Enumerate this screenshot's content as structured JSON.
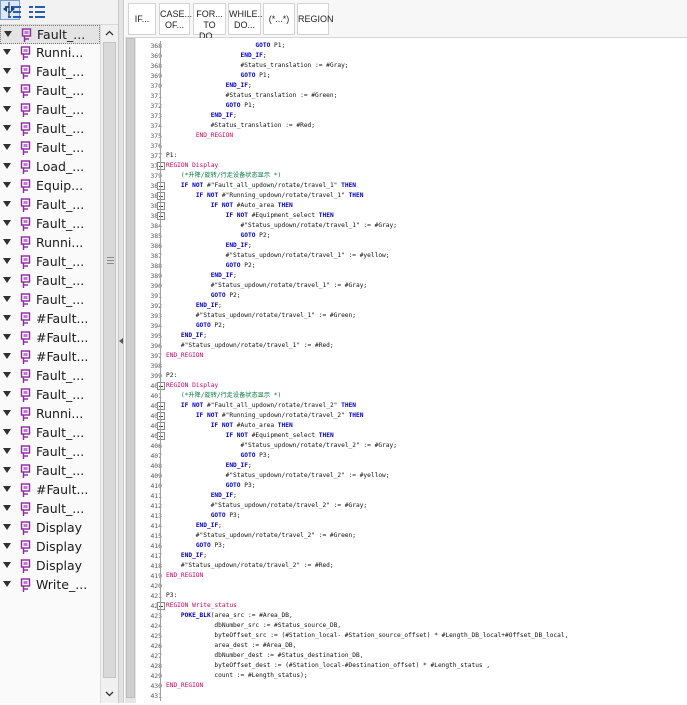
{
  "tree": {
    "items": [
      {
        "label": "Fault_..."
      },
      {
        "label": "Runni..."
      },
      {
        "label": "Fault_..."
      },
      {
        "label": "Fault_..."
      },
      {
        "label": "Fault_..."
      },
      {
        "label": "Fault_..."
      },
      {
        "label": "Fault_..."
      },
      {
        "label": "Load_..."
      },
      {
        "label": "Equip..."
      },
      {
        "label": "Fault_..."
      },
      {
        "label": "Fault_..."
      },
      {
        "label": "Runni..."
      },
      {
        "label": "Fault_..."
      },
      {
        "label": "Fault_..."
      },
      {
        "label": "Fault_..."
      },
      {
        "label": "#Fault..."
      },
      {
        "label": "#Fault..."
      },
      {
        "label": "#Fault..."
      },
      {
        "label": "Fault_..."
      },
      {
        "label": "Fault_..."
      },
      {
        "label": "Runni..."
      },
      {
        "label": "Fault_..."
      },
      {
        "label": "Fault_..."
      },
      {
        "label": "Fault_..."
      },
      {
        "label": "#Fault..."
      },
      {
        "label": "Fault_..."
      },
      {
        "label": "Display"
      },
      {
        "label": "Display"
      },
      {
        "label": "Display"
      },
      {
        "label": "Write_..."
      }
    ],
    "selected_index": 0,
    "icon": "tag-icon"
  },
  "snippets": [
    {
      "line1": "IF...",
      "line2": ""
    },
    {
      "line1": "CASE...",
      "line2": "OF..."
    },
    {
      "line1": "FOR...",
      "line2": "TO DO..."
    },
    {
      "line1": "WHILE...",
      "line2": "DO..."
    },
    {
      "line1": "(*...*)",
      "line2": ""
    },
    {
      "line1": "REGION",
      "line2": ""
    }
  ],
  "colors": {
    "keyword": "#0000cc",
    "comment": "#007a3d",
    "region": "#cc0066"
  },
  "code": [
    {
      "n": "368",
      "t": "                        GOTO P1;"
    },
    {
      "n": "369",
      "t": "                    END_IF;"
    },
    {
      "n": "368",
      "t": "                    #Status_translation := #Gray;"
    },
    {
      "n": "369",
      "t": "                    GOTO P1;"
    },
    {
      "n": "370",
      "t": "                END_IF;"
    },
    {
      "n": "371",
      "t": "                #Status_translation := #Green;"
    },
    {
      "n": "372",
      "t": "                GOTO P1;"
    },
    {
      "n": "373",
      "t": "            END_IF;"
    },
    {
      "n": "374",
      "t": "            #Status_translation := #Red;"
    },
    {
      "n": "375",
      "t": "        END_REGION"
    },
    {
      "n": "376",
      "t": ""
    },
    {
      "n": "377",
      "t": "P1:"
    },
    {
      "n": "378",
      "t": "REGION Display"
    },
    {
      "n": "379",
      "t": "    (*升降/旋转/行走设备状态显示 *)"
    },
    {
      "n": "380",
      "t": "    IF NOT #\"Fault_all_updown/rotate/travel_1\" THEN"
    },
    {
      "n": "381",
      "t": "        IF NOT #\"Running_updown/rotate/travel_1\" THEN"
    },
    {
      "n": "382",
      "t": "            IF NOT #Auto_area THEN"
    },
    {
      "n": "383",
      "t": "                IF NOT #Equipment_select THEN"
    },
    {
      "n": "384",
      "t": "                    #\"Status_updown/rotate/travel_1\" := #Gray;"
    },
    {
      "n": "385",
      "t": "                    GOTO P2;"
    },
    {
      "n": "386",
      "t": "                END_IF;"
    },
    {
      "n": "387",
      "t": "                #\"Status_updown/rotate/travel_1\" := #yellow;"
    },
    {
      "n": "388",
      "t": "                GOTO P2;"
    },
    {
      "n": "389",
      "t": "            END_IF;"
    },
    {
      "n": "390",
      "t": "            #\"Status_updown/rotate/travel_1\" := #Gray;"
    },
    {
      "n": "391",
      "t": "            GOTO P2;"
    },
    {
      "n": "392",
      "t": "        END_IF;"
    },
    {
      "n": "393",
      "t": "        #\"Status_updown/rotate/travel_1\" := #Green;"
    },
    {
      "n": "394",
      "t": "        GOTO P2;"
    },
    {
      "n": "395",
      "t": "    END_IF;"
    },
    {
      "n": "396",
      "t": "    #\"Status_updown/rotate/travel_1\" := #Red;"
    },
    {
      "n": "397",
      "t": "END_REGION"
    },
    {
      "n": "398",
      "t": ""
    },
    {
      "n": "399",
      "t": "P2:"
    },
    {
      "n": "400",
      "t": "REGION Display"
    },
    {
      "n": "401",
      "t": "    (*升降/旋转/行走设备状态显示 *)"
    },
    {
      "n": "402",
      "t": "    IF NOT #\"Fault_all_updown/rotate/travel_2\" THEN"
    },
    {
      "n": "403",
      "t": "        IF NOT #\"Running_updown/rotate/travel_2\" THEN"
    },
    {
      "n": "404",
      "t": "            IF NOT #Auto_area THEN"
    },
    {
      "n": "405",
      "t": "                IF NOT #Equipment_select THEN"
    },
    {
      "n": "406",
      "t": "                    #\"Status_updown/rotate/travel_2\" := #Gray;"
    },
    {
      "n": "407",
      "t": "                    GOTO P3;"
    },
    {
      "n": "408",
      "t": "                END_IF;"
    },
    {
      "n": "409",
      "t": "                #\"Status_updown/rotate/travel_2\" := #yellow;"
    },
    {
      "n": "410",
      "t": "                GOTO P3;"
    },
    {
      "n": "411",
      "t": "            END_IF;"
    },
    {
      "n": "412",
      "t": "            #\"Status_updown/rotate/travel_2\" := #Gray;"
    },
    {
      "n": "413",
      "t": "            GOTO P3;"
    },
    {
      "n": "414",
      "t": "        END_IF;"
    },
    {
      "n": "415",
      "t": "        #\"Status_updown/rotate/travel_2\" := #Green;"
    },
    {
      "n": "416",
      "t": "        GOTO P3;"
    },
    {
      "n": "417",
      "t": "    END_IF;"
    },
    {
      "n": "418",
      "t": "    #\"Status_updown/rotate/travel_2\" := #Red;"
    },
    {
      "n": "419",
      "t": "END_REGION"
    },
    {
      "n": "420",
      "t": ""
    },
    {
      "n": "421",
      "t": "P3:"
    },
    {
      "n": "422",
      "t": "REGION Write_status"
    },
    {
      "n": "423",
      "t": "    POKE_BLK(area_src := #Area_DB,"
    },
    {
      "n": "424",
      "t": "             dbNumber_src := #Status_source_DB,"
    },
    {
      "n": "425",
      "t": "             byteOffset_src := (#Station_local- #Station_source_offset) * #Length_DB_local+#Offset_DB_local,"
    },
    {
      "n": "426",
      "t": "             area_dest := #Area_DB,"
    },
    {
      "n": "427",
      "t": "             dbNumber_dest := #Status_destination_DB,"
    },
    {
      "n": "428",
      "t": "             byteOffset_dest := (#Station_local-#Destination_offset) * #Length_status ,"
    },
    {
      "n": "429",
      "t": "             count := #Length_status);"
    },
    {
      "n": "430",
      "t": "END_REGION"
    },
    {
      "n": "431",
      "t": ""
    }
  ]
}
